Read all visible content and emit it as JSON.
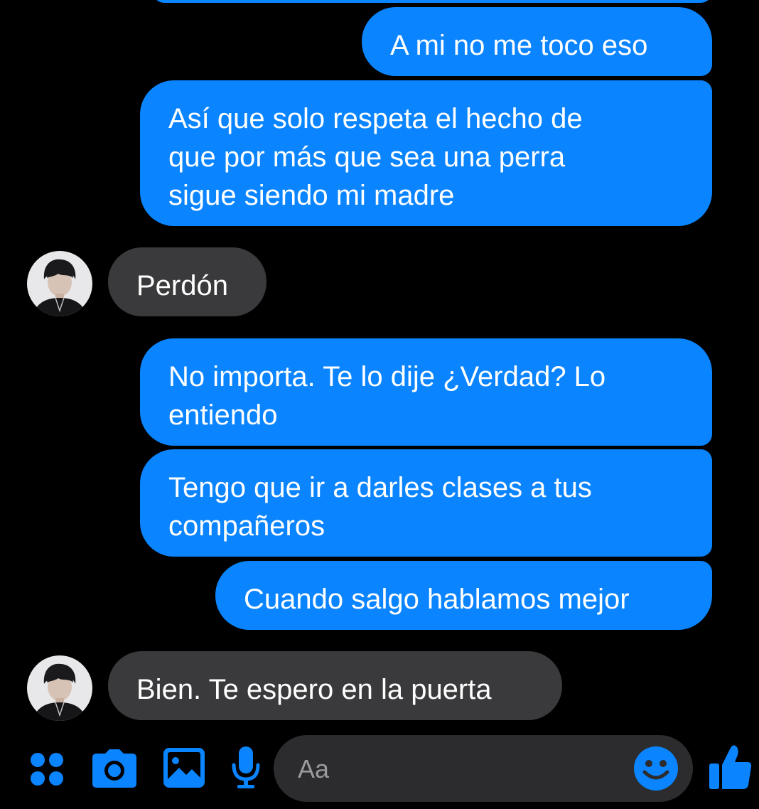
{
  "messages": [
    {
      "direction": "sent",
      "text": "A mi no me toco eso"
    },
    {
      "direction": "sent",
      "text": "Así que solo respeta el hecho de\nque por más que sea una perra\nsigue siendo mi madre"
    },
    {
      "direction": "received",
      "text": "Perdón"
    },
    {
      "direction": "sent",
      "text": "No importa. Te lo dije ¿Verdad? Lo\nentiendo"
    },
    {
      "direction": "sent",
      "text": "Tengo que ir a darles clases a tus\ncompañeros"
    },
    {
      "direction": "sent",
      "text": "Cuando salgo hablamos mejor"
    },
    {
      "direction": "received",
      "text": "Bien. Te espero en la puerta"
    }
  ],
  "composer": {
    "placeholder": "Aa"
  },
  "icons": {
    "toolbar": [
      "apps-icon",
      "camera-icon",
      "gallery-icon",
      "microphone-icon"
    ],
    "composer": "emoji-icon",
    "send": "thumbs-up-icon"
  },
  "colors": {
    "background": "#000000",
    "sent_bubble": "#0a84ff",
    "received_bubble": "#3a3a3c",
    "accent": "#0a84ff",
    "composer_bg": "#2c2c2e"
  }
}
